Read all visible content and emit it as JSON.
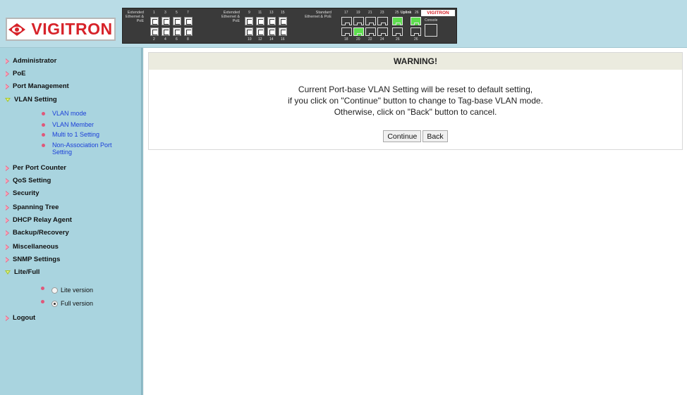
{
  "header": {
    "brand": "VIGITRON",
    "panel": {
      "groups": [
        {
          "label": "Extended Ethernet & PoE",
          "top_nums": [
            "1",
            "3",
            "5",
            "7"
          ],
          "bottom_nums": [
            "2",
            "4",
            "6",
            "8"
          ]
        },
        {
          "label": "Extended Ethernet & PoE",
          "top_nums": [
            "9",
            "11",
            "13",
            "15"
          ],
          "bottom_nums": [
            "10",
            "12",
            "14",
            "16"
          ]
        },
        {
          "label": "Standard Ethernet & PoE",
          "top_nums": [
            "17",
            "19",
            "21",
            "23"
          ],
          "bottom_nums": [
            "18",
            "20",
            "22",
            "24"
          ]
        }
      ],
      "uplink_label": "Uplink",
      "uplink_nums_top": [
        "25",
        "26"
      ],
      "uplink_nums_bottom": [
        "26",
        "26"
      ],
      "mini_brand": "VIGITRON",
      "console_label": "Console",
      "port_status": {
        "17": "down",
        "19": "down",
        "21": "down",
        "23": "down",
        "18": "down",
        "20": "up",
        "22": "down",
        "24": "down",
        "25": "up",
        "26a": "up",
        "26b": "down",
        "26c": "down"
      },
      "colors": {
        "link_up": "#5ddd4e",
        "panel_bg": "#3a3a3a"
      }
    }
  },
  "sidebar": {
    "items": [
      {
        "label": "Administrator",
        "icon": "arrow-right-icon"
      },
      {
        "label": "PoE",
        "icon": "arrow-right-icon"
      },
      {
        "label": "Port Management",
        "icon": "arrow-right-icon"
      },
      {
        "label": "VLAN Setting",
        "icon": "arrow-down-icon",
        "expanded": true
      },
      {
        "label": "Per Port Counter",
        "icon": "arrow-right-icon"
      },
      {
        "label": "QoS Setting",
        "icon": "arrow-right-icon"
      },
      {
        "label": "Security",
        "icon": "arrow-right-icon"
      },
      {
        "label": "Spanning Tree",
        "icon": "arrow-right-icon"
      },
      {
        "label": "DHCP Relay Agent",
        "icon": "arrow-right-icon"
      },
      {
        "label": "Backup/Recovery",
        "icon": "arrow-right-icon"
      },
      {
        "label": "Miscellaneous",
        "icon": "arrow-right-icon"
      },
      {
        "label": "SNMP Settings",
        "icon": "arrow-right-icon"
      },
      {
        "label": "Lite/Full",
        "icon": "arrow-down-icon",
        "expanded": true
      },
      {
        "label": "Logout",
        "icon": "arrow-right-icon"
      }
    ],
    "vlan_subitems": [
      "VLAN mode",
      "VLAN Member",
      "Multi to 1 Setting",
      "Non-Association Port Setting"
    ],
    "version_options": [
      {
        "label": "Lite version",
        "selected": false
      },
      {
        "label": "Full version",
        "selected": true
      }
    ],
    "colors": {
      "background": "#a9d4df",
      "link": "#1b3fd8",
      "arrow": "#e0587a",
      "arrow_expanded": "#a7c72f"
    }
  },
  "main": {
    "warning": {
      "title": "WARNING!",
      "lines": [
        "Current Port-base VLAN Setting will be reset to default setting,",
        "if you click on \"Continue\" button to change to Tag-base VLAN mode.",
        "Otherwise, click on \"Back\" button to cancel."
      ],
      "continue_label": "Continue",
      "back_label": "Back"
    }
  }
}
